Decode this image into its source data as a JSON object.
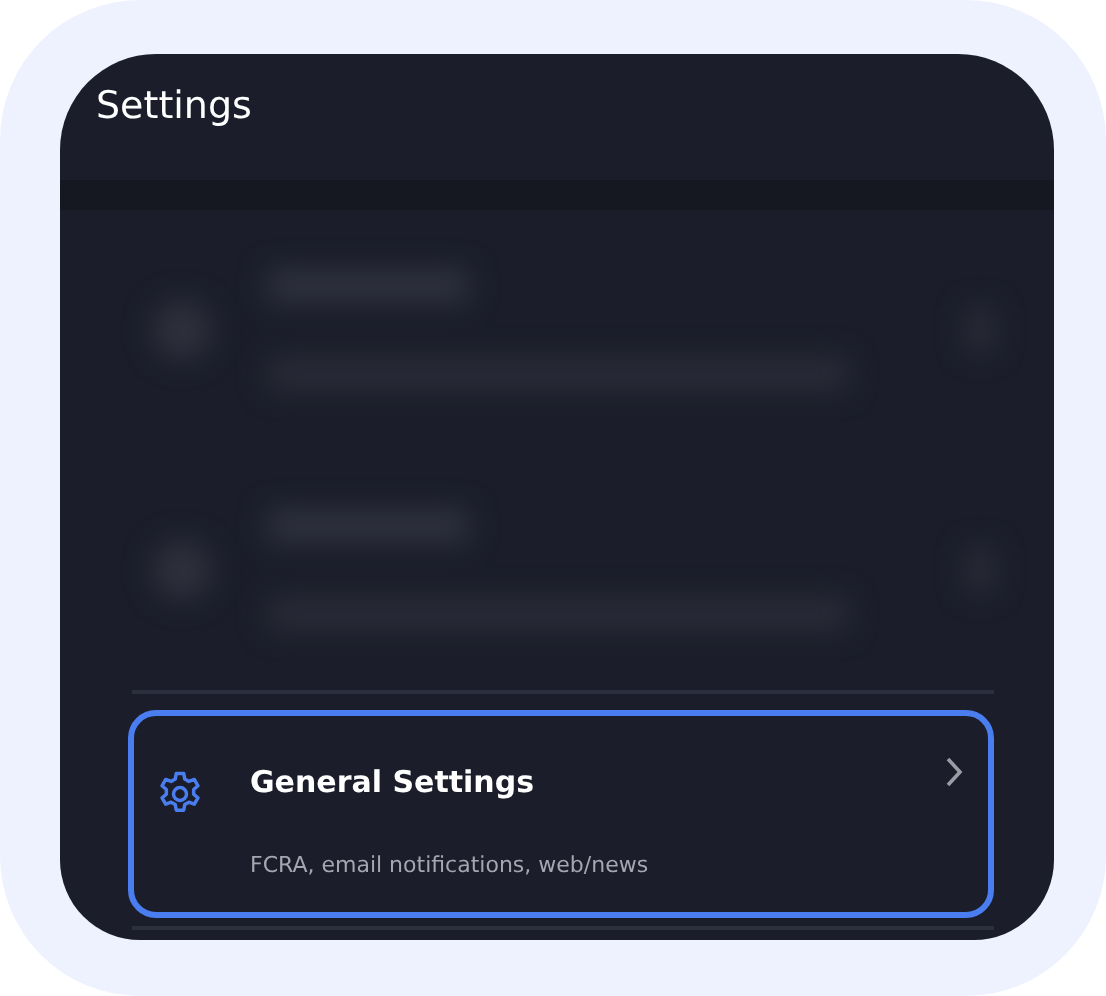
{
  "header": {
    "title": "Settings"
  },
  "items": [
    {
      "kind": "blurred"
    },
    {
      "kind": "blurred"
    },
    {
      "kind": "entry",
      "title": "General Settings",
      "subtitle": "FCRA, email notifications, web/news",
      "selected": true
    }
  ]
}
